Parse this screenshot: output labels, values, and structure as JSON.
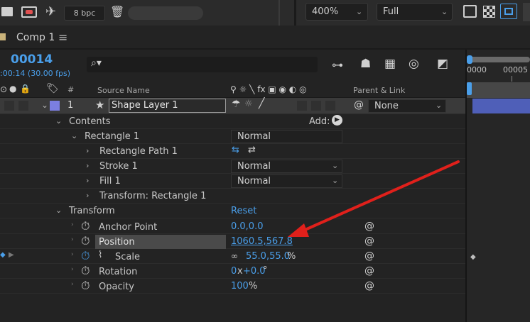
{
  "toolbar": {
    "bpc": "8 bpc",
    "zoom": "400%",
    "resolution": "Full"
  },
  "comp": {
    "tab_label": "Comp 1",
    "menu_glyph": "≡",
    "timecode": "00014",
    "timecode_sub": ":00:14 (30.00 fps)",
    "search_placeholder": ""
  },
  "timeline_ruler": {
    "label_a": "0000",
    "label_b": "00005"
  },
  "columns": {
    "hash": "#",
    "source_name": "Source Name",
    "switches_glyphs": "⚲ ☼ ╲ fx ▣ ◉ ◐ ◎",
    "parent_link": "Parent & Link"
  },
  "layer": {
    "index": "1",
    "name": "Shape Layer 1",
    "parent": "None",
    "label_color": "#7b7fe0"
  },
  "tree": {
    "contents": "Contents",
    "add_label": "Add:",
    "rectangle": "Rectangle 1",
    "rectangle_mode": "Normal",
    "rect_path": "Rectangle Path 1",
    "stroke": "Stroke 1",
    "stroke_mode": "Normal",
    "fill": "Fill 1",
    "fill_mode": "Normal",
    "transform_rect": "Transform: Rectangle 1",
    "transform": "Transform",
    "reset": "Reset"
  },
  "properties": {
    "anchor_label": "Anchor Point",
    "anchor_value": "0.0,0.0",
    "position_label": "Position",
    "position_value": "1060.5,567.8",
    "scale_label": "Scale",
    "scale_value": "55.0,55.0",
    "scale_unit": "%",
    "rotation_label": "Rotation",
    "rotation_turns": "0",
    "rotation_x": "x",
    "rotation_deg": "+0.0",
    "rotation_unit": "°",
    "opacity_label": "Opacity",
    "opacity_value": "100",
    "opacity_unit": "%"
  },
  "colors": {
    "accent_blue": "#4a9fea",
    "arrow_red": "#e0201b",
    "timeline_bar": "#4f5fb8"
  }
}
